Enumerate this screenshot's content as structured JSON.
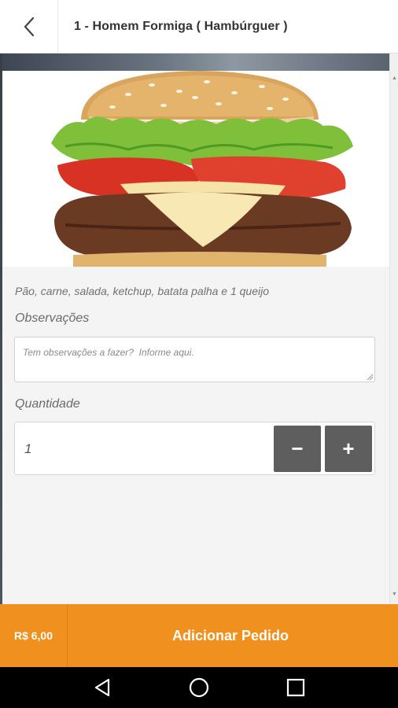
{
  "header": {
    "title": "1 - Homem Formiga ( Hambúrguer )"
  },
  "product": {
    "description": "Pão, carne, salada, ketchup, batata palha e 1 queijo"
  },
  "observations": {
    "label": "Observações",
    "placeholder": "Tem observações a fazer?  Informe aqui.",
    "value": ""
  },
  "quantity": {
    "label": "Quantidade",
    "value": "1",
    "minus_label": "−",
    "plus_label": "+"
  },
  "footer": {
    "price": "R$ 6,00",
    "add_label": "Adicionar Pedido"
  },
  "colors": {
    "accent": "#f0901e",
    "button_gray": "#5e5e5e"
  },
  "icons": {
    "back": "chevron-left-icon",
    "nav_back": "triangle-back-icon",
    "nav_home": "circle-home-icon",
    "nav_recents": "square-recents-icon"
  }
}
